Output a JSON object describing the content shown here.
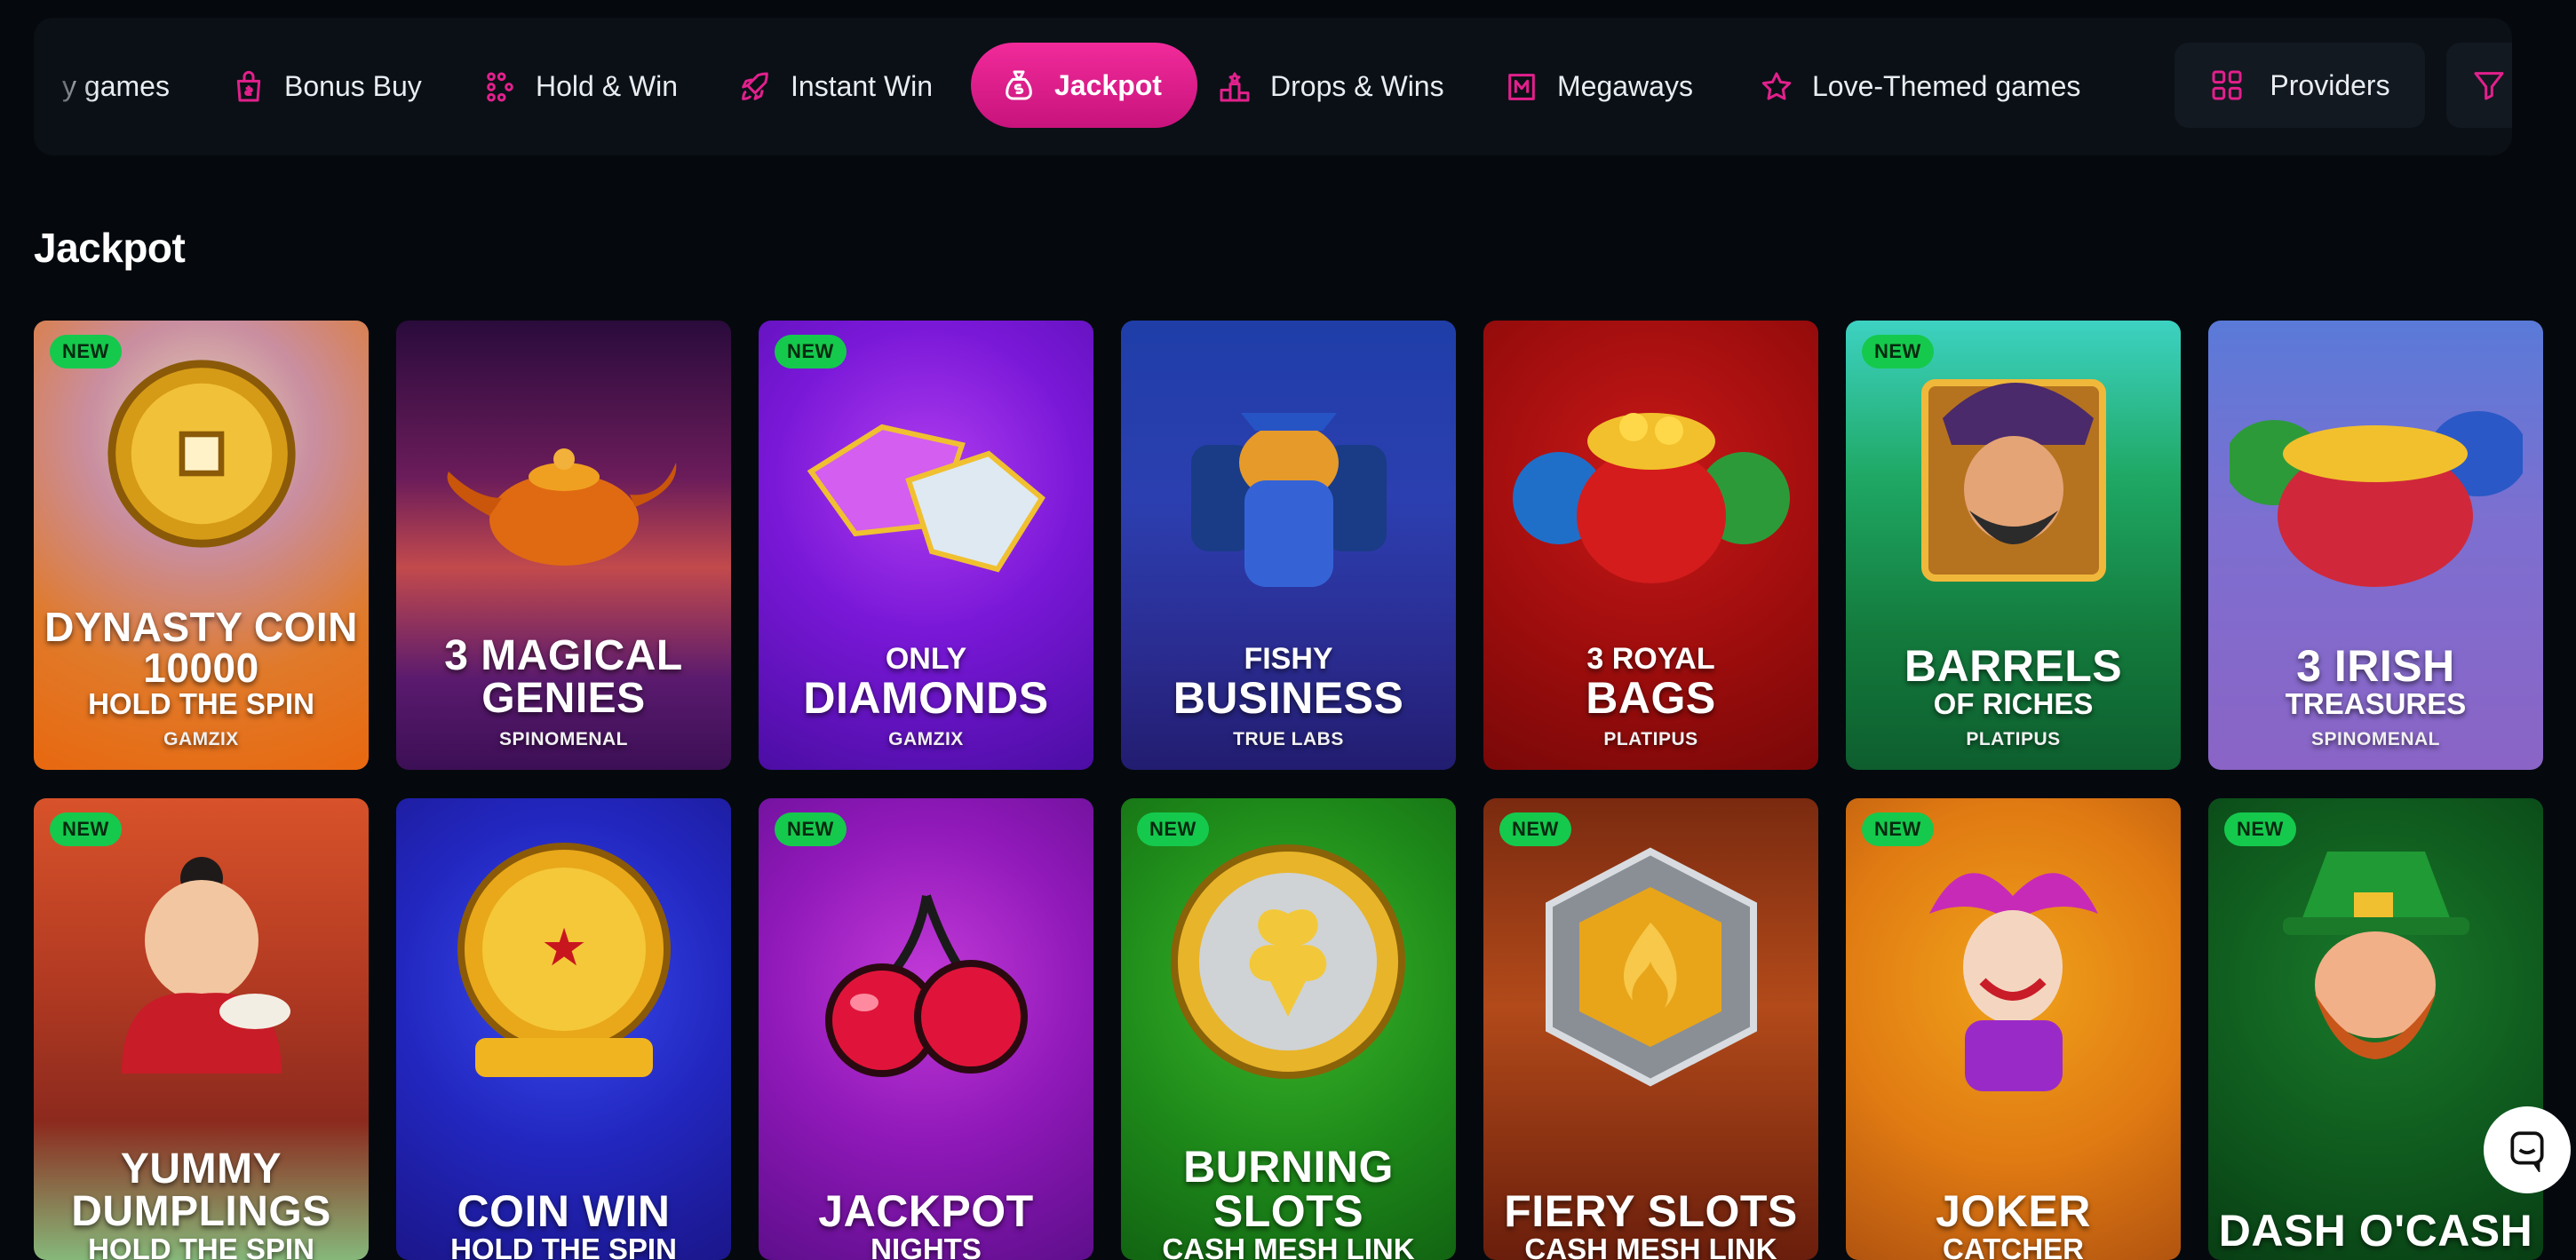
{
  "nav": {
    "categories": [
      {
        "label": "y games",
        "icon": "none"
      },
      {
        "label": "Bonus Buy",
        "icon": "gift-bag-icon"
      },
      {
        "label": "Hold & Win",
        "icon": "grid-dots-icon"
      },
      {
        "label": "Instant Win",
        "icon": "rocket-icon"
      },
      {
        "label": "Jackpot",
        "icon": "money-bag-icon",
        "active": true
      },
      {
        "label": "Drops & Wins",
        "icon": "podium-icon"
      },
      {
        "label": "Megaways",
        "icon": "megaways-icon"
      },
      {
        "label": "Love-Themed games",
        "icon": "star-icon"
      }
    ],
    "providers_label": "Providers",
    "accent": "#e2208c"
  },
  "section": {
    "title": "Jackpot"
  },
  "badge_text": "NEW",
  "games": [
    {
      "small": "",
      "main": "DYNASTY COIN 10000",
      "sub": "HOLD THE SPIN",
      "provider": "GAMZIX",
      "new": true,
      "bg": "orange"
    },
    {
      "small": "",
      "main": "3 MAGICAL GENIES",
      "sub": "",
      "provider": "SPINOMENAL",
      "new": false,
      "bg": "purple-sunset"
    },
    {
      "small": "ONLY",
      "main": "DIAMONDS",
      "sub": "",
      "provider": "GAMZIX",
      "new": true,
      "bg": "violet"
    },
    {
      "small": "FISHY",
      "main": "BUSINESS",
      "sub": "",
      "provider": "TRUE LABS",
      "new": false,
      "bg": "blue"
    },
    {
      "small": "3 ROYAL",
      "main": "BAGS",
      "sub": "",
      "provider": "PLATIPUS",
      "new": false,
      "bg": "red"
    },
    {
      "small": "",
      "main": "BARRELS",
      "sub": "OF RICHES",
      "provider": "PLATIPUS",
      "new": true,
      "bg": "green"
    },
    {
      "small": "",
      "main": "3 IRISH",
      "sub": "TREASURES",
      "provider": "SPINOMENAL",
      "new": false,
      "bg": "lilac"
    },
    {
      "small": "",
      "main": "YUMMY DUMPLINGS",
      "sub": "HOLD THE SPIN",
      "provider": "",
      "new": true,
      "bg": "red-green"
    },
    {
      "small": "",
      "main": "COIN WIN",
      "sub": "HOLD THE SPIN",
      "provider": "",
      "new": false,
      "bg": "deep-blue"
    },
    {
      "small": "",
      "main": "JACKPOT",
      "sub": "NIGHTS",
      "provider": "",
      "new": true,
      "bg": "magenta"
    },
    {
      "small": "",
      "main": "BURNING SLOTS",
      "sub": "CASH MESH LINK",
      "provider": "",
      "new": true,
      "bg": "bright-green"
    },
    {
      "small": "",
      "main": "FIERY SLOTS",
      "sub": "CASH MESH LINK",
      "provider": "",
      "new": true,
      "bg": "fire"
    },
    {
      "small": "",
      "main": "JOKER",
      "sub": "CATCHER",
      "provider": "",
      "new": true,
      "bg": "amber"
    },
    {
      "small": "",
      "main": "DASH O'CASH",
      "sub": "",
      "provider": "",
      "new": true,
      "bg": "forest"
    }
  ],
  "chat": {
    "icon": "chat-icon"
  }
}
